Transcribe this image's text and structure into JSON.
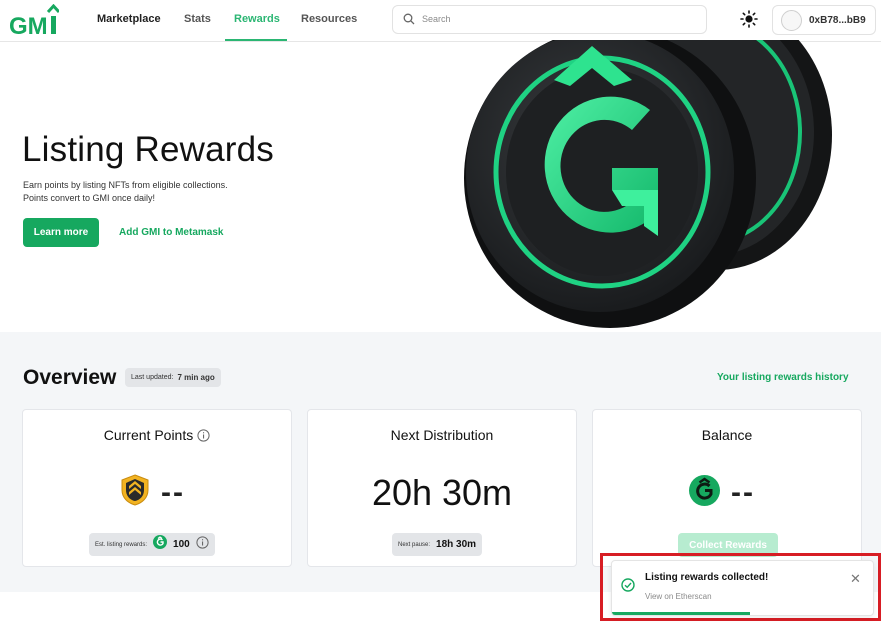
{
  "nav": {
    "logo_text": "GMI",
    "links": [
      {
        "label": "Marketplace"
      },
      {
        "label": "Stats"
      },
      {
        "label": "Rewards"
      },
      {
        "label": "Resources"
      }
    ],
    "search_placeholder": "Search",
    "wallet_address": "0xB78...bB9",
    "accent_color": "#2bb673"
  },
  "hero": {
    "title": "Listing Rewards",
    "description_line1": "Earn points by listing NFTs from eligible collections.",
    "description_line2": "Points convert to GMI once daily!",
    "learn_more": "Learn more",
    "add_gmi": "Add GMI to Metamask"
  },
  "overview": {
    "title": "Overview",
    "last_updated_label": "Last updated:",
    "last_updated_value": "7 min ago",
    "history_link": "Your listing rewards history",
    "cards": {
      "points": {
        "title": "Current Points",
        "value": "--",
        "pill_label": "Est. listing rewards:",
        "pill_value": "100"
      },
      "distribution": {
        "title": "Next Distribution",
        "value": "20h 30m",
        "pill_label": "Next pause:",
        "pill_value": "18h 30m"
      },
      "balance": {
        "title": "Balance",
        "value": "--",
        "button": "Collect Rewards"
      }
    }
  },
  "toast": {
    "title": "Listing rewards collected!",
    "link": "View on Etherscan",
    "progress": 0.53,
    "status_color": "#16a85f"
  }
}
